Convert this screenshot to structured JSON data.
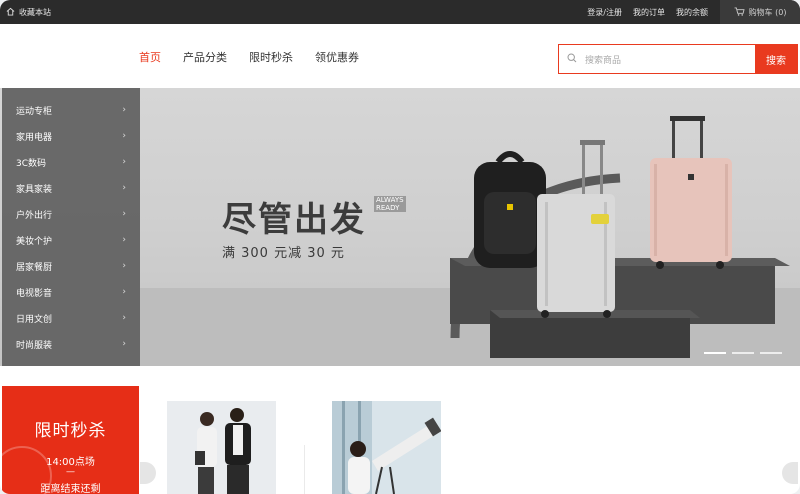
{
  "topbar": {
    "favorite": "收藏本站",
    "login": "登录/注册",
    "orders": "我的订单",
    "balance": "我的余额",
    "cart": "购物车 (0)"
  },
  "nav": {
    "items": [
      "首页",
      "产品分类",
      "限时秒杀",
      "领优惠券"
    ]
  },
  "search": {
    "placeholder": "搜索商品",
    "button": "搜索"
  },
  "categories": [
    "运动专柜",
    "家用电器",
    "3C数码",
    "家具家装",
    "户外出行",
    "美妆个护",
    "居家餐厨",
    "电视影音",
    "日用文创",
    "时尚服装"
  ],
  "banner": {
    "headline": "尽管出发",
    "english_line1": "ALWAYS",
    "english_line2": "READY",
    "promo": "满 300 元减 30 元"
  },
  "flash_sale": {
    "title": "限时秒杀",
    "time": "14:00点场",
    "dash": "—",
    "countdown": "距离结束还剩"
  },
  "colors": {
    "accent": "#e93a1f",
    "topbar": "#2b2b2b"
  }
}
